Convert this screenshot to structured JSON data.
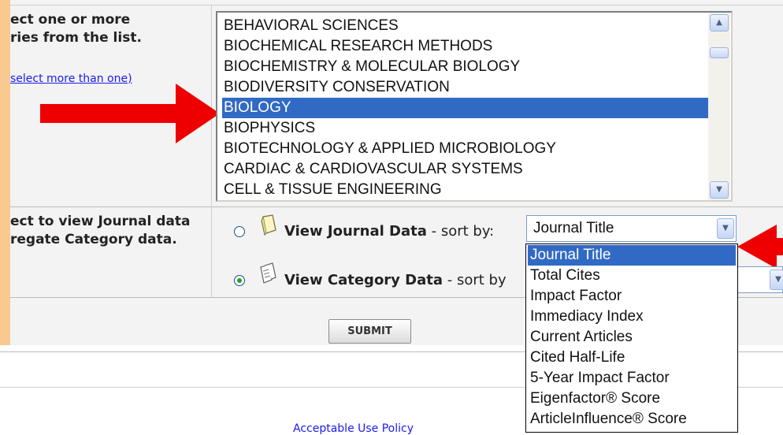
{
  "category_prompt": {
    "line1": "ect one or more",
    "line2": "ries from the list.",
    "help_link": "select more than one)"
  },
  "categories": [
    "BEHAVIORAL SCIENCES",
    "BIOCHEMICAL RESEARCH METHODS",
    "BIOCHEMISTRY & MOLECULAR BIOLOGY",
    "BIODIVERSITY CONSERVATION",
    "BIOLOGY",
    "BIOPHYSICS",
    "BIOTECHNOLOGY & APPLIED MICROBIOLOGY",
    "CARDIAC & CARDIOVASCULAR SYSTEMS",
    "CELL & TISSUE ENGINEERING"
  ],
  "selected_category": "BIOLOGY",
  "view_prompt": {
    "line1": "ect to view Journal data",
    "line2": "regate Category data."
  },
  "view_journal": {
    "label": "View Journal Data",
    "sort_text": " - sort by:",
    "checked": false
  },
  "view_category": {
    "label": "View Category Data",
    "sort_text": " - sort by",
    "checked": true
  },
  "sort_select": {
    "value": "Journal Title"
  },
  "sort_options": [
    "Journal Title",
    "Total Cites",
    "Impact Factor",
    "Immediacy Index",
    "Current Articles",
    "Cited Half-Life",
    "5-Year Impact Factor",
    "Eigenfactor® Score",
    "ArticleInfluence® Score"
  ],
  "submit_label": "SUBMIT",
  "footer_link": "Acceptable Use Policy",
  "icons": {
    "scroll_up": "chevron-up-icon",
    "scroll_down": "chevron-down-icon",
    "journal": "journal-icon",
    "category": "category-icon",
    "annotation": "red-arrow-icon"
  },
  "colors": {
    "selection": "#316ac5",
    "arrow": "#ee0000",
    "side_bar": "#f9c98f"
  }
}
